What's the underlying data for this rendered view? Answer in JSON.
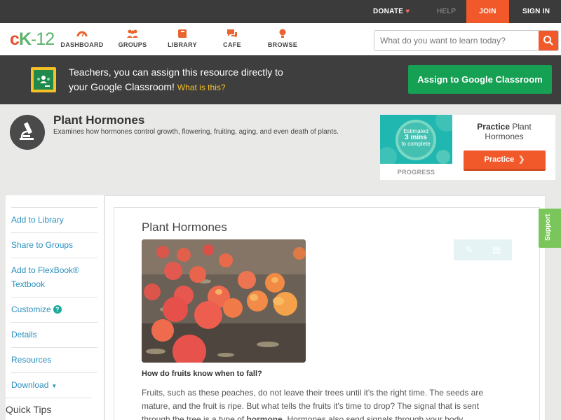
{
  "topbar": {
    "donate": "DONATE",
    "help": "HELP",
    "join": "JOIN",
    "signin": "SIGN IN"
  },
  "nav": {
    "logo_c": "c",
    "logo_k": "K",
    "logo_rest": "-12",
    "items": [
      {
        "label": "DASHBOARD",
        "icon": "dashboard-icon"
      },
      {
        "label": "GROUPS",
        "icon": "groups-icon"
      },
      {
        "label": "LIBRARY",
        "icon": "library-icon"
      },
      {
        "label": "CAFE",
        "icon": "cafe-icon"
      },
      {
        "label": "BROWSE",
        "icon": "browse-icon"
      }
    ],
    "search_placeholder": "What do you want to learn today?"
  },
  "banner": {
    "line1": "Teachers, you can assign this resource directly to",
    "line2": "your Google Classroom!",
    "what_link": "What is this?",
    "assign_button": "Assign to Google Classroom"
  },
  "resource": {
    "title": "Plant Hormones",
    "description": "Examines how hormones control growth, flowering, fruiting, aging, and even death of plants."
  },
  "practice": {
    "estimated": "Estimated",
    "mins": "3 mins",
    "to_complete": "to complete",
    "progress_label": "PROGRESS",
    "practice_word": "Practice",
    "practice_topic": "Plant Hormones",
    "button": "Practice"
  },
  "sidebar": {
    "items": [
      {
        "label": "Add to Library"
      },
      {
        "label": "Share to Groups"
      },
      {
        "label": "Add to FlexBook® Textbook"
      },
      {
        "label": "Customize"
      },
      {
        "label": "Details"
      },
      {
        "label": "Resources"
      },
      {
        "label": "Download"
      }
    ],
    "quick_tips": "Quick Tips"
  },
  "content": {
    "title": "Plant Hormones",
    "question": "How do fruits know when to fall?",
    "paragraph_pre": "Fruits, such as these peaches, do not leave their trees until it's the right time. The seeds are mature, and the fruit is ripe. But what tells the fruits it's time to drop? The signal that is sent through the tree is a type of ",
    "paragraph_bold": "hormone",
    "paragraph_post": ". Hormones also send signals through your body"
  },
  "support": "Support",
  "colors": {
    "accent": "#f1592a",
    "link": "#2b8fbf",
    "classroom_green": "#15a053",
    "support_green": "#7bc65a"
  }
}
